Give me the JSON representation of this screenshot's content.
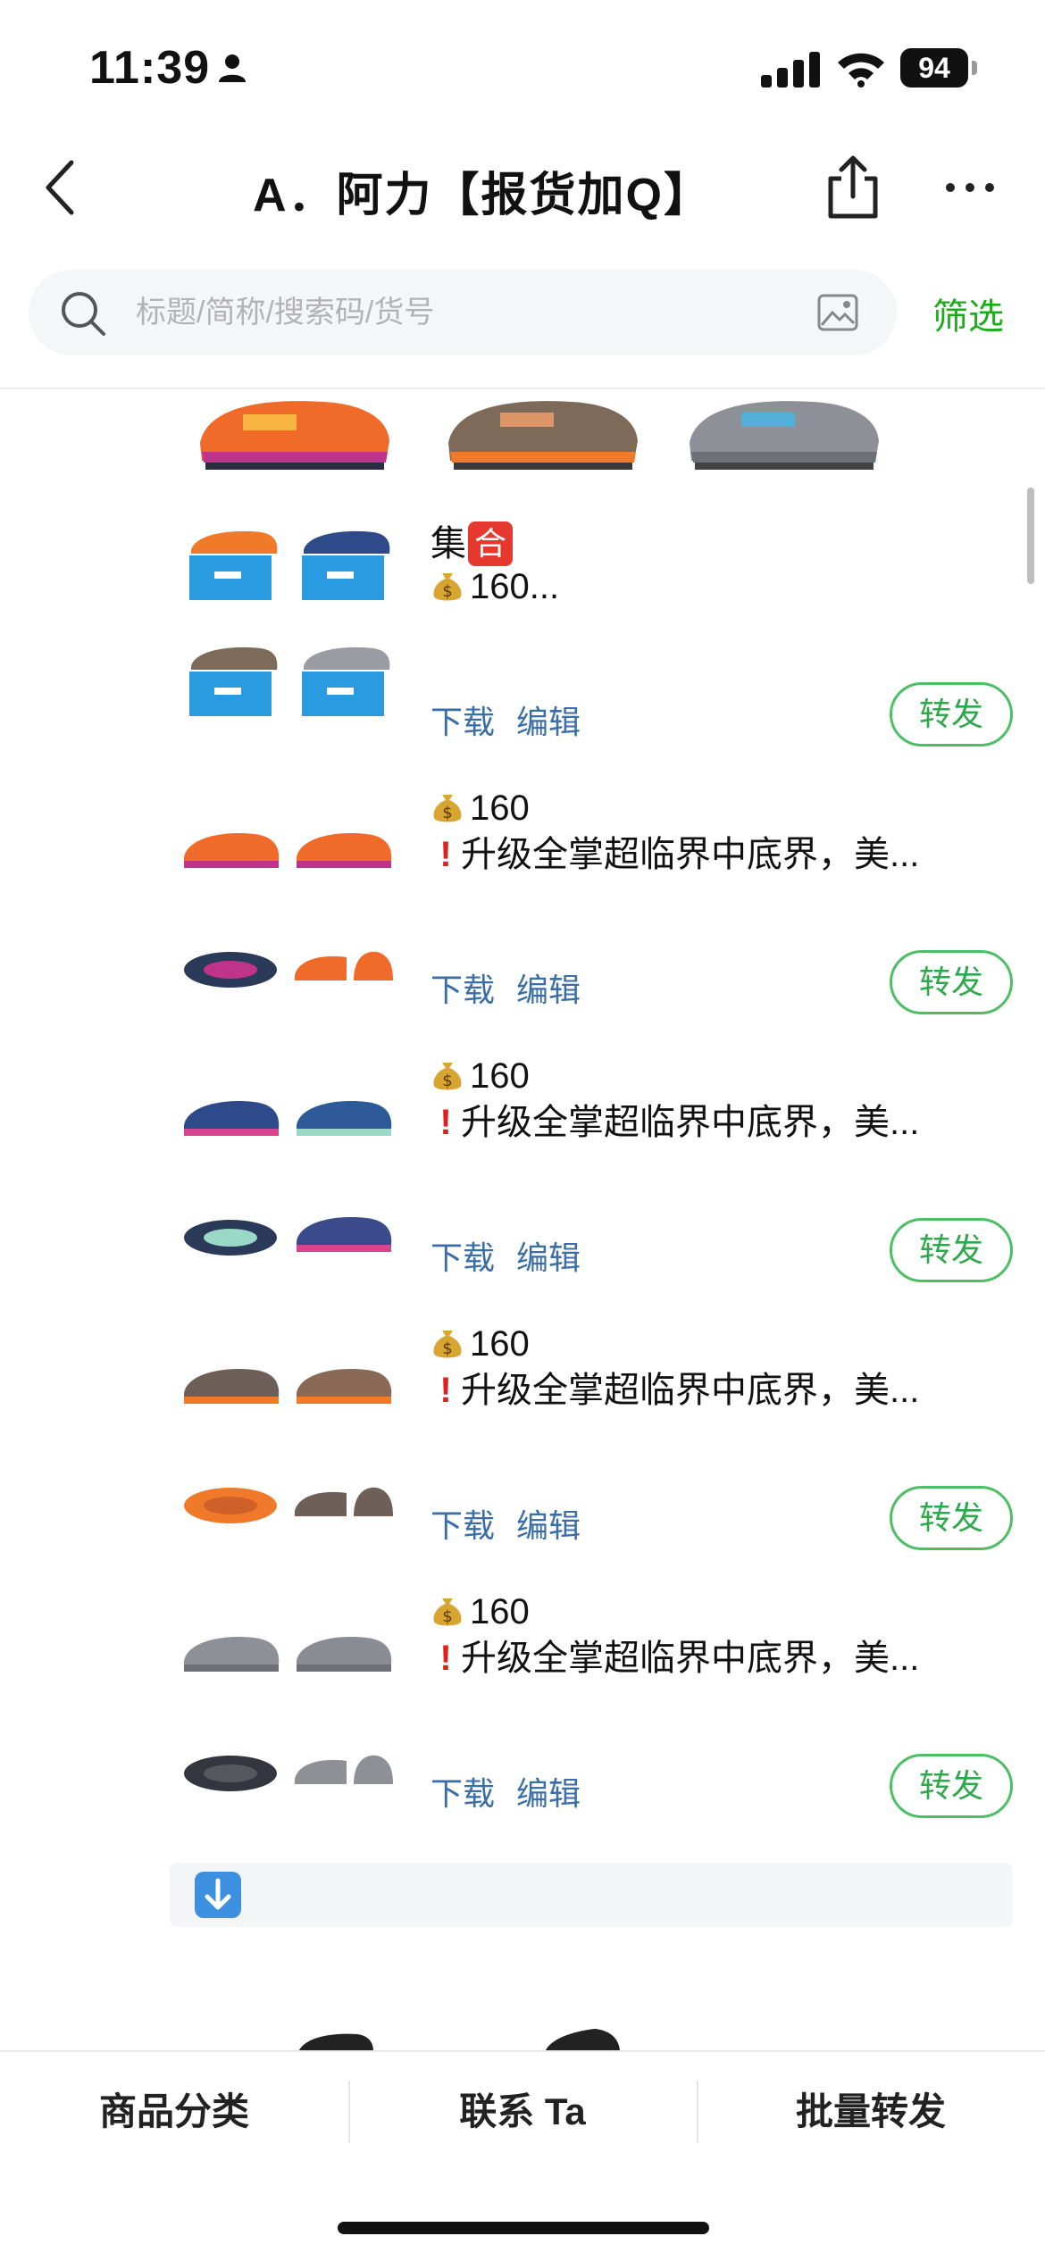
{
  "status_bar": {
    "time": "11:39",
    "battery": "94"
  },
  "nav": {
    "title": "A．阿力【报货加Q】"
  },
  "search": {
    "placeholder": "标题/简称/搜索码/货号",
    "filter_label": "筛选"
  },
  "items": [
    {
      "title_text": "集",
      "badge": "合",
      "line2": "160...",
      "download_label": "下载",
      "edit_label": "编辑",
      "forward_label": "转发"
    },
    {
      "price": "160",
      "desc": "升级全掌超临界中底界，美...",
      "download_label": "下载",
      "edit_label": "编辑",
      "forward_label": "转发"
    },
    {
      "price": "160",
      "desc": "升级全掌超临界中底界，美...",
      "download_label": "下载",
      "edit_label": "编辑",
      "forward_label": "转发"
    },
    {
      "price": "160",
      "desc": "升级全掌超临界中底界，美...",
      "download_label": "下载",
      "edit_label": "编辑",
      "forward_label": "转发"
    },
    {
      "price": "160",
      "desc": "升级全掌超临界中底界，美...",
      "download_label": "下载",
      "edit_label": "编辑",
      "forward_label": "转发"
    }
  ],
  "tab_bar": {
    "categories": "商品分类",
    "contact": "联系 Ta",
    "batch_forward": "批量转发"
  },
  "colors": {
    "accent_green": "#1aad19",
    "link_blue": "#3a6ea8",
    "button_border": "#4cbf64"
  }
}
